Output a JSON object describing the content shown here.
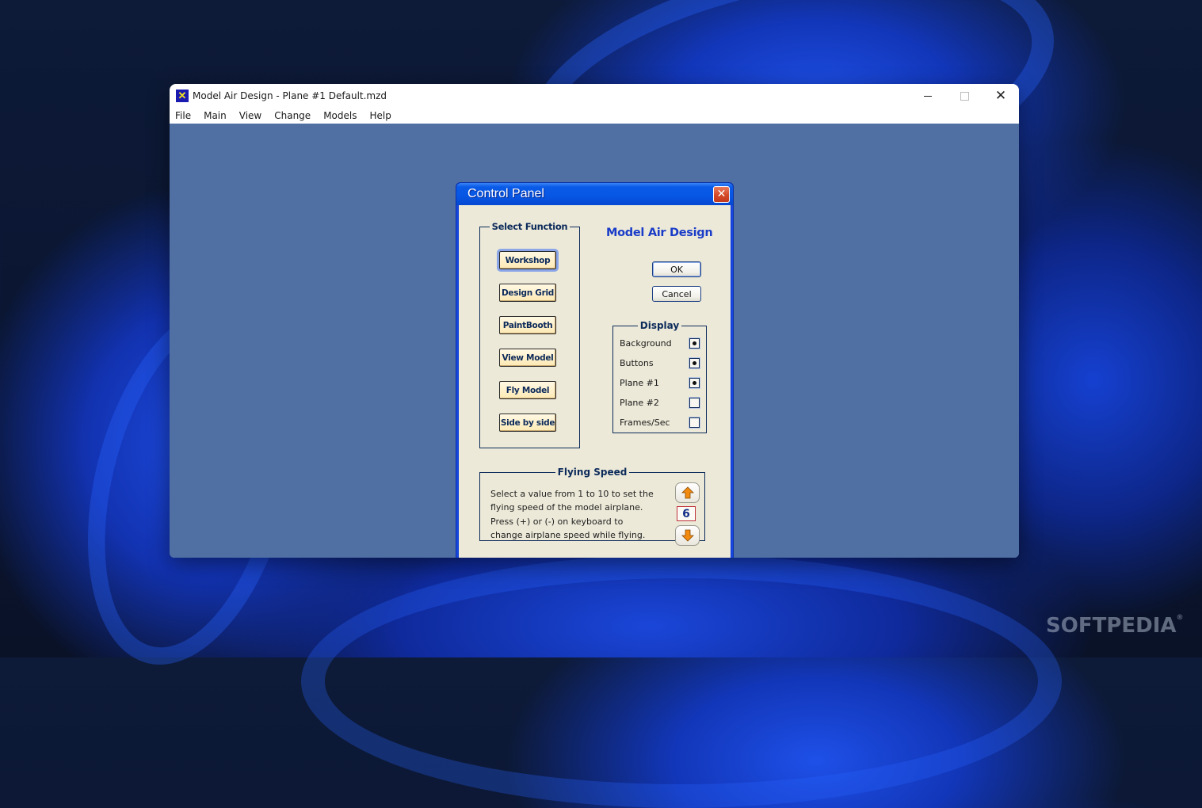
{
  "window": {
    "title": "Model Air Design - Plane #1  Default.mzd",
    "icon": "model-air-design-app-icon",
    "controls": {
      "minimize": "minimize",
      "maximize": "maximize",
      "close": "close"
    }
  },
  "menu": [
    "File",
    "Main",
    "View",
    "Change",
    "Models",
    "Help"
  ],
  "dialog": {
    "title": "Control Panel",
    "brand": "Model Air Design",
    "select_function": {
      "legend": "Select Function",
      "buttons": [
        "Workshop",
        "Design Grid",
        "PaintBooth",
        "View Model",
        "Fly Model",
        "Side by side"
      ],
      "active": "Workshop"
    },
    "ok_label": "OK",
    "cancel_label": "Cancel",
    "display": {
      "legend": "Display",
      "items": [
        {
          "label": "Background",
          "checked": true
        },
        {
          "label": "Buttons",
          "checked": true
        },
        {
          "label": "Plane #1",
          "checked": true
        },
        {
          "label": "Plane #2",
          "checked": false
        },
        {
          "label": "Frames/Sec",
          "checked": false
        }
      ]
    },
    "flying_speed": {
      "legend": "Flying Speed",
      "description_lines": [
        "Select a value from 1 to 10 to set the",
        "flying speed of the model airplane.",
        "Press (+) or (-) on keyboard to",
        "change airplane speed while flying."
      ],
      "value": "6",
      "min": 1,
      "max": 10
    }
  },
  "watermark": "SOFTPEDIA"
}
